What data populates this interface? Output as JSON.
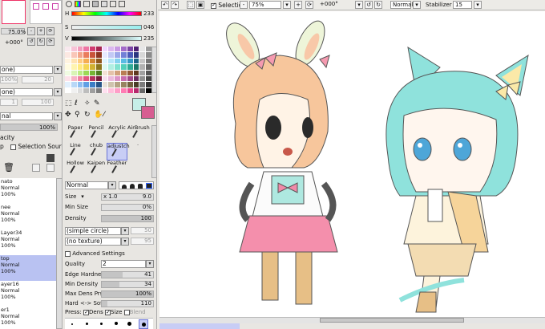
{
  "navigator": {
    "zoom": "75.0%",
    "rotation": "+000°"
  },
  "left_panel": {
    "dropdown1": "one)",
    "num1": "100%",
    "num1b": "20",
    "dropdown2": "one)",
    "num2": "1",
    "num2b": "100",
    "blend_mode": "nal",
    "opacity_value": "100%",
    "opacity_label": "acity",
    "selection_source_label_pre": "p",
    "selection_source_label": "Selection Source",
    "layers": [
      {
        "name": "nato",
        "mode": "Normal",
        "opacity": "100%"
      },
      {
        "name": "nee",
        "mode": "Normal",
        "opacity": "100%"
      },
      {
        "name": "Layer34",
        "mode": "Normal",
        "opacity": "100%"
      },
      {
        "name": "top",
        "mode": "Normal",
        "opacity": "100%"
      },
      {
        "name": "ayer16",
        "mode": "Normal",
        "opacity": "100%"
      },
      {
        "name": "er1",
        "mode": "Normal",
        "opacity": "100%"
      }
    ]
  },
  "color": {
    "h_label": "H",
    "h_value": "233",
    "s_label": "S",
    "s_value": "046",
    "v_label": "V",
    "v_value": "235",
    "swatches": [
      "#f8e8ee",
      "#f7c3d6",
      "#f39bbb",
      "#ee75a3",
      "#d23a70",
      "#a72550",
      "#f2d6ff",
      "#dcb8f0",
      "#c89ae3",
      "#a36bc9",
      "#7a43a4",
      "#4d1f72",
      "#e6e6e6",
      "#9c9c9c",
      "#fce8e2",
      "#f9c6b8",
      "#f2a489",
      "#ea7c5c",
      "#c9533a",
      "#8d3522",
      "#e6e9ff",
      "#c2c9f5",
      "#9ba6e9",
      "#7381d7",
      "#4b5ab8",
      "#2b357f",
      "#d8d8d8",
      "#8a8a8a",
      "#fff3df",
      "#ffe3b3",
      "#ffcc80",
      "#f5ad52",
      "#d18432",
      "#8f561d",
      "#dff5ff",
      "#b5e6fa",
      "#85d2f1",
      "#59bbe4",
      "#3496c4",
      "#1d6488",
      "#c6c6c6",
      "#777777",
      "#fffbe0",
      "#fff4b0",
      "#ffea7f",
      "#f4d653",
      "#d1b131",
      "#8c761d",
      "#defaf3",
      "#b0efe2",
      "#80e2cf",
      "#52cfb9",
      "#2fab95",
      "#1c7565",
      "#b2b2b2",
      "#666666",
      "#f0fbe2",
      "#d8f4b5",
      "#bcea84",
      "#9bd957",
      "#76b535",
      "#4f7d20",
      "#f3e2d6",
      "#e4c2aa",
      "#d2a17c",
      "#b97d54",
      "#925936",
      "#5f391f",
      "#a0a0a0",
      "#555555",
      "#fde2ea",
      "#f7b3c6",
      "#f080a0",
      "#e15681",
      "#b3325d",
      "#7a1e3d",
      "#f7e1f0",
      "#ecbcdd",
      "#dd95c8",
      "#c86cae",
      "#a04789",
      "#6b2c5d",
      "#8e8e8e",
      "#444444",
      "#e2f0fd",
      "#b8d8f7",
      "#8cbdf0",
      "#5f9fe4",
      "#3a7ec6",
      "#265588",
      "#e8e2d8",
      "#cfc3ae",
      "#b5a384",
      "#978460",
      "#72613f",
      "#4a3e27",
      "#7b7b7b",
      "#333333",
      "#ffffff",
      "#f0f0f0",
      "#dcdcdc",
      "#bdbdbd",
      "#9e9e9e",
      "#7e7e7e",
      "#ffe0f0",
      "#ffc0dc",
      "#ff9ec8",
      "#ff7bb3",
      "#e94b91",
      "#b5286b",
      "#686868",
      "#000000"
    ],
    "fg_color": "#c6efe8",
    "bg_color": "#d75d91"
  },
  "tools": {
    "row1": [
      "Paper",
      "Pencil",
      "Acrylic",
      "AirBrush"
    ],
    "row2": [
      "Line",
      "chub",
      "adjustch",
      "·"
    ],
    "row3": [
      "Hollow",
      "Kaipen",
      "Feather",
      ""
    ]
  },
  "brush": {
    "mode": "Normal",
    "size_label": "Size",
    "size_mult": "x 1.0",
    "size_value": "9.0",
    "min_size_label": "Min Size",
    "min_size_value": "0%",
    "min_size_fraction": 0.0,
    "density_label": "Density",
    "density_value": "100",
    "density_fraction": 1.0,
    "shape": "(simple circle)",
    "shape_value": "50",
    "texture": "(no texture)",
    "texture_value": "95",
    "advanced_label": "Advanced Settings",
    "quality_label": "Quality",
    "quality_value": "2",
    "edge_label": "Edge Hardness",
    "edge_value": "41",
    "edge_fraction": 0.41,
    "min_density_label": "Min Density",
    "min_density_value": "34",
    "min_density_fraction": 0.34,
    "max_dens_label": "Max Dens Prs.",
    "max_dens_value": "100%",
    "max_dens_fraction": 1.0,
    "hard_soft_label": "Hard <-> Soft",
    "hard_soft_value": "110",
    "hard_soft_fraction": 0.11,
    "press_label": "Press:",
    "press_dens": "Dens",
    "press_size": "Size",
    "press_blend": "Blend"
  },
  "toolbar": {
    "selection_label": "Selection",
    "zoom": "75%",
    "rotation": "+000°",
    "mode": "Normal",
    "stabilizer_label": "Stabilizer",
    "stabilizer_value": "15"
  }
}
